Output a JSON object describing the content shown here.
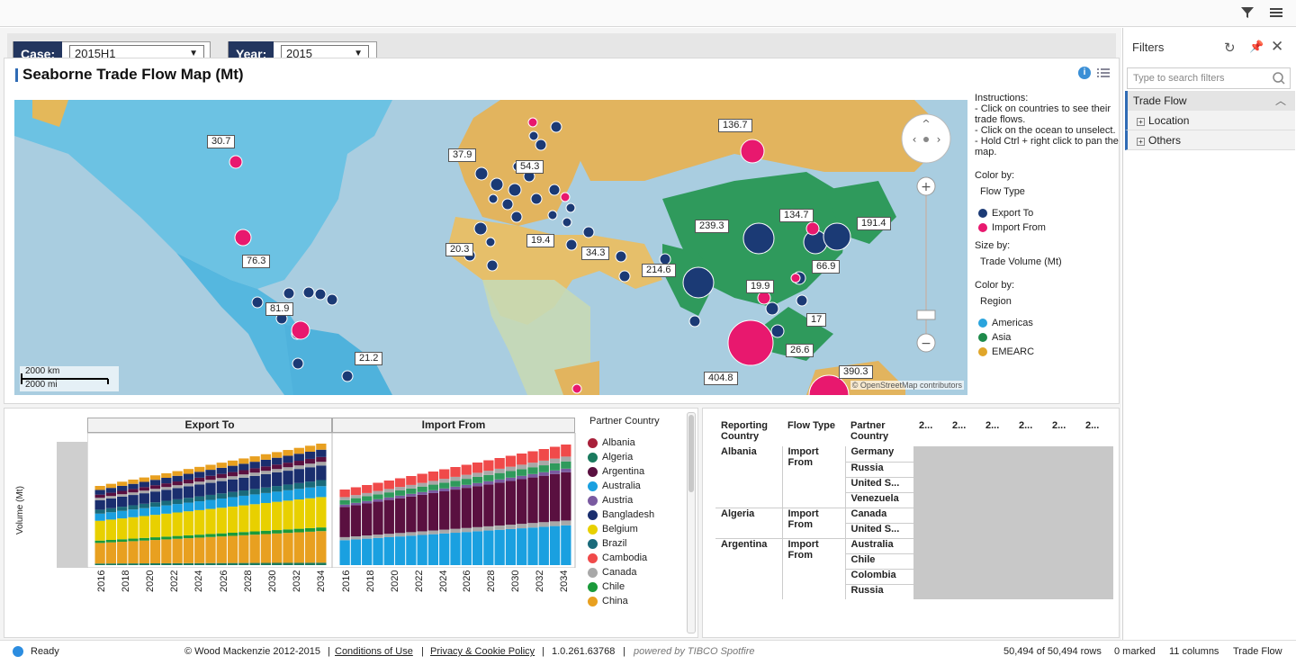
{
  "controls": {
    "case_label": "Case:",
    "case_value": "2015H1",
    "year_label": "Year:",
    "year_value": "2015"
  },
  "map_panel": {
    "title": "Seaborne Trade Flow Map (Mt)",
    "labels": [
      "30.7",
      "37.9",
      "54.3",
      "136.7",
      "134.7",
      "191.4",
      "239.3",
      "66.9",
      "20.3",
      "19.4",
      "34.3",
      "214.6",
      "19.9",
      "17",
      "26.6",
      "404.8",
      "390.3",
      "76.3",
      "81.9",
      "21.2"
    ],
    "scale_km": "2000 km",
    "scale_mi": "2000 mi",
    "attribution": "© OpenStreetMap contributors"
  },
  "legend": {
    "instructions": [
      "Instructions:",
      "- Click on countries to see their trade flows.",
      "- Click on the ocean to unselect.",
      "- Hold Ctrl + right click to pan the map."
    ],
    "color_by_label": "Color by:",
    "color_by_value": "Flow Type",
    "flow_types": [
      {
        "name": "Export To",
        "color": "#1b3a75"
      },
      {
        "name": "Import From",
        "color": "#e8186e"
      }
    ],
    "size_by_label": "Size by:",
    "size_by_value": "Trade Volume (Mt)",
    "color_by2_label": "Color by:",
    "color_by2_value": "Region",
    "regions": [
      {
        "name": "Americas",
        "color": "#2aa4dd"
      },
      {
        "name": "Asia",
        "color": "#1e8a4a"
      },
      {
        "name": "EMEARC",
        "color": "#e0a62a"
      }
    ]
  },
  "chart_panel": {
    "export_title": "Export To",
    "import_title": "Import From",
    "ylabel": "Volume (Mt)",
    "xticks": [
      "2016",
      "2018",
      "2020",
      "2022",
      "2024",
      "2026",
      "2028",
      "2030",
      "2032",
      "2034"
    ],
    "partner_legend_title": "Partner Country",
    "partners": [
      {
        "name": "Albania",
        "color": "#a8203a"
      },
      {
        "name": "Algeria",
        "color": "#1a7a5e"
      },
      {
        "name": "Argentina",
        "color": "#5a1040"
      },
      {
        "name": "Australia",
        "color": "#1aa0e0"
      },
      {
        "name": "Austria",
        "color": "#7a5aa0"
      },
      {
        "name": "Bangladesh",
        "color": "#1a2e6e"
      },
      {
        "name": "Belgium",
        "color": "#e8d000"
      },
      {
        "name": "Brazil",
        "color": "#1a6a7a"
      },
      {
        "name": "Cambodia",
        "color": "#f04a4a"
      },
      {
        "name": "Canada",
        "color": "#a8a8a8"
      },
      {
        "name": "Chile",
        "color": "#1a9a3a"
      },
      {
        "name": "China",
        "color": "#e8a020"
      }
    ]
  },
  "table": {
    "headers": [
      "Reporting Country",
      "Flow Type",
      "Partner Country",
      "2...",
      "2...",
      "2...",
      "2...",
      "2...",
      "2..."
    ],
    "rows": [
      {
        "country": "Albania",
        "flow": "Import From",
        "partners": [
          "Germany",
          "Russia",
          "United S...",
          "Venezuela"
        ]
      },
      {
        "country": "Algeria",
        "flow": "Import From",
        "partners": [
          "Canada",
          "United S..."
        ]
      },
      {
        "country": "Argentina",
        "flow": "Import From",
        "partners": [
          "Australia",
          "Chile",
          "Colombia",
          "Russia"
        ]
      }
    ]
  },
  "filters": {
    "title": "Filters",
    "search_placeholder": "Type to search filters",
    "groups": [
      "Trade Flow",
      "Location",
      "Others"
    ]
  },
  "status": {
    "ready": "Ready",
    "copyright": "© Wood Mackenzie 2012-2015",
    "conditions": "Conditions of Use",
    "privacy": "Privacy & Cookie Policy",
    "version": "1.0.261.63768",
    "powered": "powered by TIBCO Spotfire",
    "rows": "50,494 of 50,494 rows",
    "marked": "0 marked",
    "columns": "11 columns",
    "table": "Trade Flow"
  }
}
